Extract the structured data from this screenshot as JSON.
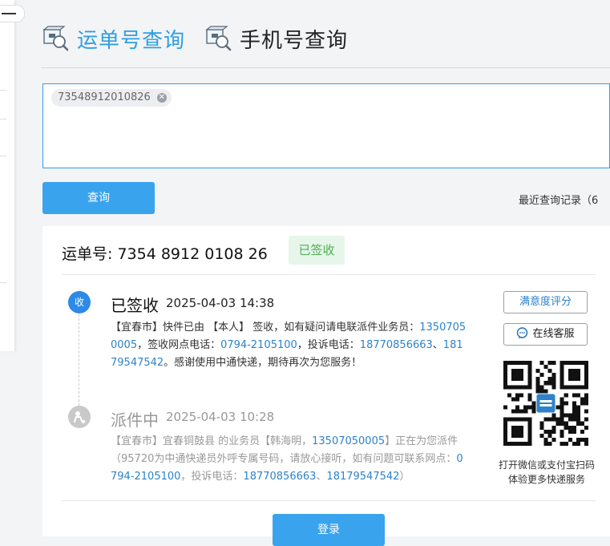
{
  "tabs": [
    {
      "label": "运单号查询",
      "icon": "parcel-search-icon",
      "active": true
    },
    {
      "label": "手机号查询",
      "icon": "parcel-search-icon",
      "active": false
    }
  ],
  "input": {
    "chip": "73548912010826"
  },
  "buttons": {
    "query": "查询",
    "login": "登录"
  },
  "recent_history": "最近查询记录（6",
  "result": {
    "waybill": "运单号: 7354 8912 0108 26",
    "status_badge": "已签收",
    "events": [
      {
        "dot": "收",
        "status": "已签收",
        "time": "2025-04-03 14:38",
        "desc": [
          {
            "text": "【宜春市】快件已由 【本人】 签收，如有疑问请电联派件业务员：",
            "link": false
          },
          {
            "text": "13507050005",
            "link": true
          },
          {
            "text": "，签收网点电话：",
            "link": false
          },
          {
            "text": "0794-2105100",
            "link": true
          },
          {
            "text": "，投诉电话：",
            "link": false
          },
          {
            "text": "18770856663",
            "link": true
          },
          {
            "text": "、",
            "link": false
          },
          {
            "text": "18179547542",
            "link": true
          },
          {
            "text": "。感谢使用中通快递，期待再次为您服务！",
            "link": false
          }
        ]
      },
      {
        "dot": "",
        "dot_icon": "courier-icon",
        "status": "派件中",
        "time": "2025-04-03 10:28",
        "desc": [
          {
            "text": "【宜春市】宜春铜鼓县 的业务员【韩海明，",
            "link": false
          },
          {
            "text": "13507050005",
            "link": true
          },
          {
            "text": "】正在为您派件（95720为中通快递员外呼专属号码，请放心接听，如有问题可联系网点：",
            "link": false
          },
          {
            "text": "0794-2105100",
            "link": true
          },
          {
            "text": "，投诉电话：",
            "link": false
          },
          {
            "text": "18770856663",
            "link": true
          },
          {
            "text": "、",
            "link": false
          },
          {
            "text": "18179547542",
            "link": true
          },
          {
            "text": "）",
            "link": false
          }
        ]
      }
    ],
    "rate_button": "满意度评分",
    "chat_button": "在线客服",
    "qr_caption": [
      "打开微信或支付宝扫码",
      "体验更多快递服务"
    ]
  },
  "colors": {
    "accent": "#2e9ee3",
    "button": "#3aa3ee",
    "link": "#2e82c9",
    "signed_bg": "#e6f6ea",
    "signed_text": "#4caf50"
  }
}
